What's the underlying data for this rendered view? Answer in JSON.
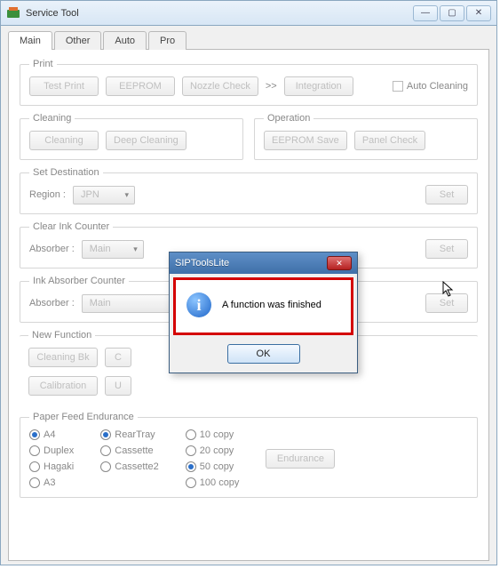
{
  "window": {
    "title": "Service Tool"
  },
  "tabs": [
    "Main",
    "Other",
    "Auto",
    "Pro"
  ],
  "groups": {
    "print": {
      "legend": "Print",
      "test": "Test Print",
      "eeprom": "EEPROM",
      "nozzle": "Nozzle Check",
      "chev": ">>",
      "integration": "Integration",
      "autoClean": "Auto Cleaning"
    },
    "cleaning": {
      "legend": "Cleaning",
      "clean": "Cleaning",
      "deep": "Deep Cleaning"
    },
    "operation": {
      "legend": "Operation",
      "save": "EEPROM Save",
      "panel": "Panel Check"
    },
    "setDest": {
      "legend": "Set Destination",
      "region": "Region :",
      "val": "JPN",
      "set": "Set"
    },
    "clearInk": {
      "legend": "Clear Ink Counter",
      "absorber": "Absorber :",
      "val": "Main",
      "set": "Set"
    },
    "inkAbs": {
      "legend": "Ink Absorber Counter",
      "absorber": "Absorber :",
      "val": "Main",
      "set": "Set"
    },
    "newFunc": {
      "legend": "New Function",
      "cleanBk": "Cleaning Bk",
      "c": "C",
      "calib": "Calibration",
      "u": "U"
    },
    "paper": {
      "legend": "Paper Feed Endurance",
      "endurance": "Endurance",
      "col1": [
        "A4",
        "Duplex",
        "Hagaki",
        "A3"
      ],
      "col2": [
        "RearTray",
        "Cassette",
        "Cassette2"
      ],
      "col3": [
        "10 copy",
        "20 copy",
        "50 copy",
        "100 copy"
      ],
      "sel1": "A4",
      "sel2": "RearTray",
      "sel3": "50 copy"
    }
  },
  "dialog": {
    "title": "SIPToolsLite",
    "msg": "A function was finished",
    "ok": "OK"
  }
}
